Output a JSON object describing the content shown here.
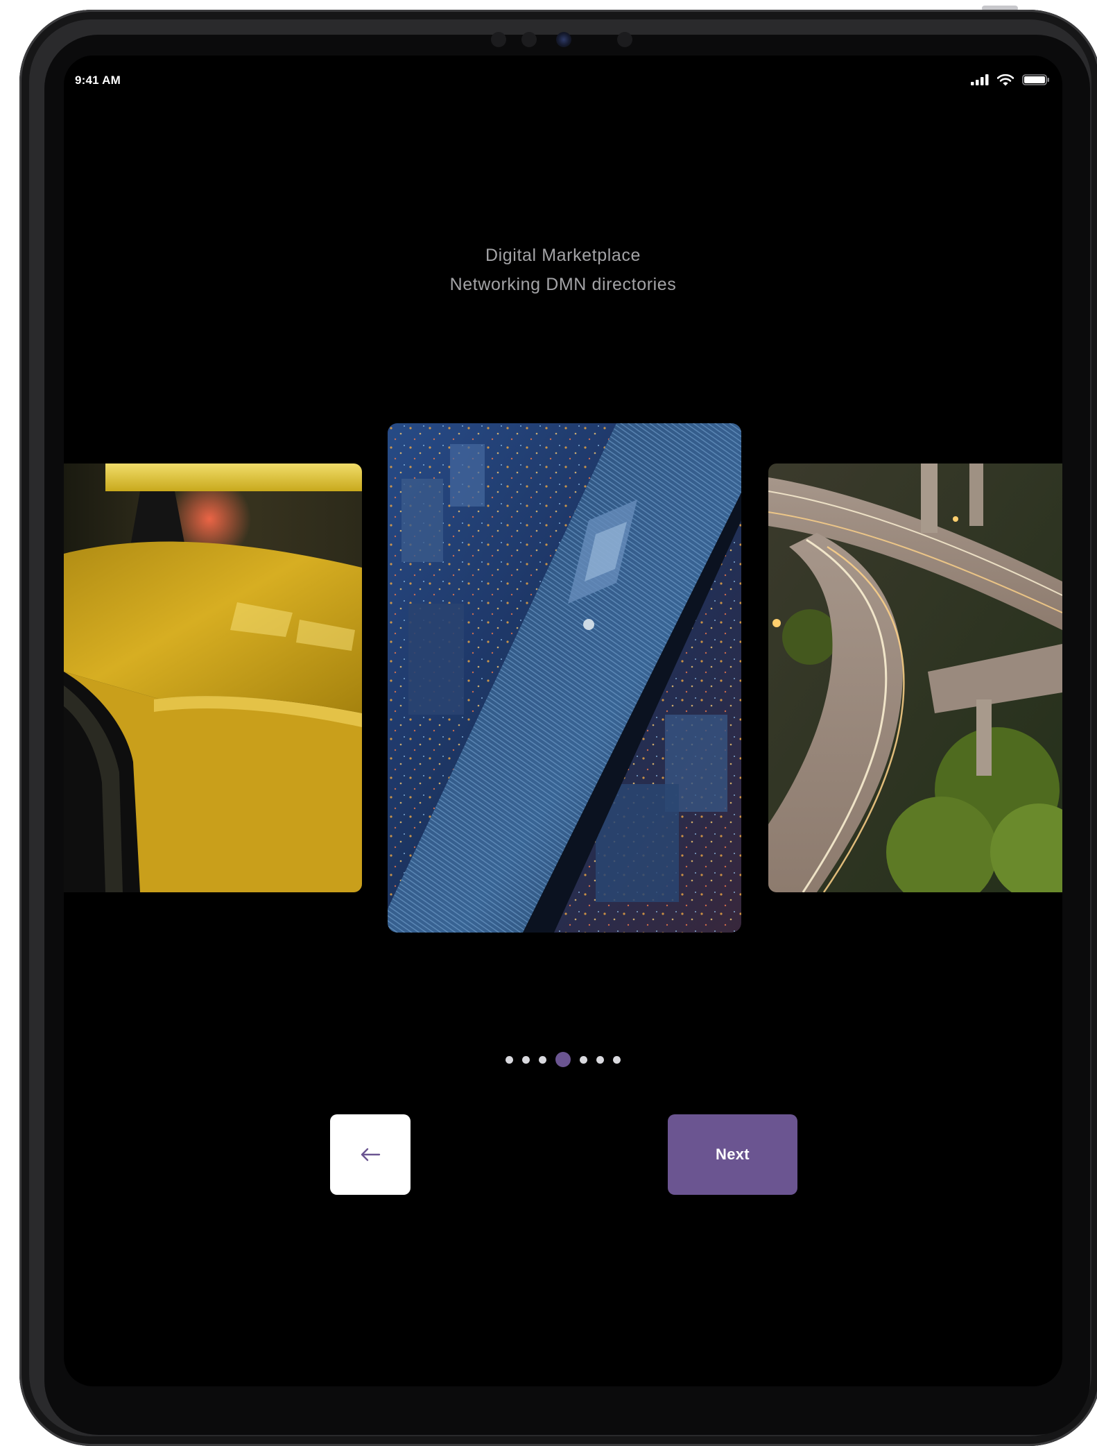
{
  "status_bar": {
    "time": "9:41 AM",
    "icons": [
      "cellular-signal-icon",
      "wifi-icon",
      "battery-icon"
    ]
  },
  "onboarding": {
    "title_line1": "Digital Marketplace",
    "title_line2": "Networking DMN directories"
  },
  "carousel": {
    "slides": [
      {
        "name": "yellow-taxi-roof"
      },
      {
        "name": "aerial-skyscraper-city"
      },
      {
        "name": "highway-interchange-night"
      }
    ],
    "page_count": 7,
    "active_index": 3
  },
  "navigation": {
    "back_icon": "arrow-left-icon",
    "next_label": "Next"
  },
  "colors": {
    "accent": "#6b5591",
    "screen_background": "#000000",
    "headline_text": "#a3a3a6",
    "dot_inactive": "#d9d9de",
    "back_button_bg": "#ffffff"
  }
}
